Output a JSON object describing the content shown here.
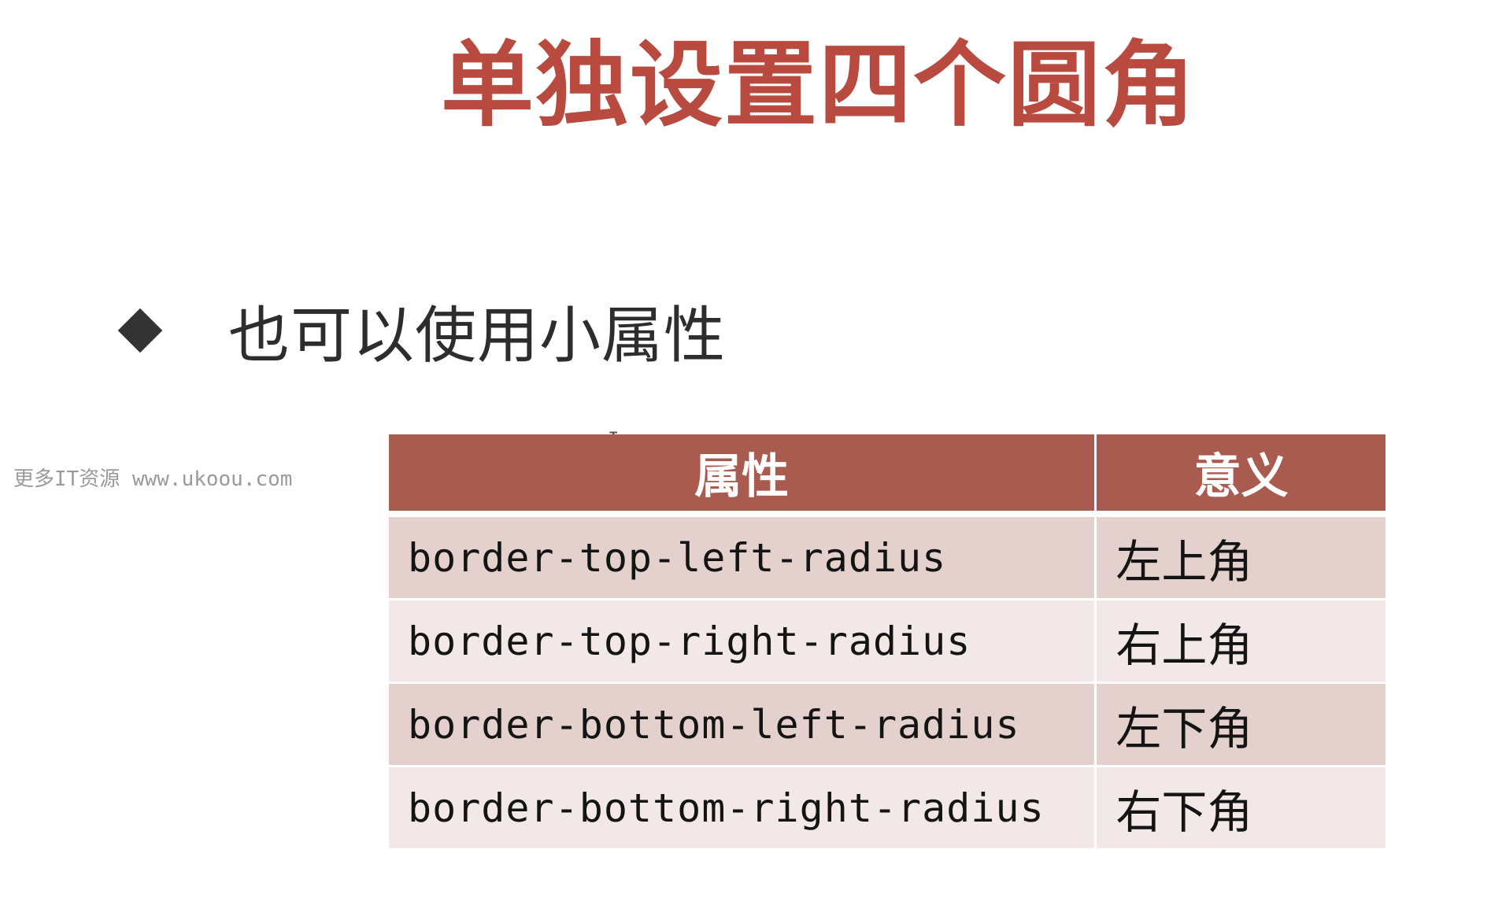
{
  "slide": {
    "title": "单独设置四个圆角",
    "bullet": "也可以使用小属性",
    "watermark": "更多IT资源 www.ukoou.com",
    "cursor_glyph": "I"
  },
  "table": {
    "headers": [
      "属性",
      "意义"
    ],
    "rows": [
      {
        "property": "border-top-left-radius",
        "meaning": "左上角"
      },
      {
        "property": "border-top-right-radius",
        "meaning": "右上角"
      },
      {
        "property": "border-bottom-left-radius",
        "meaning": "左下角"
      },
      {
        "property": "border-bottom-right-radius",
        "meaning": "右下角"
      }
    ]
  },
  "colors": {
    "title": "#b84a3f",
    "header_bg": "#a95b4f",
    "row_odd_bg": "#e4d0cd",
    "row_even_bg": "#f2e8e7",
    "bullet_icon": "#333333"
  },
  "icons": {
    "bullet": "diamond-bullet-icon"
  }
}
